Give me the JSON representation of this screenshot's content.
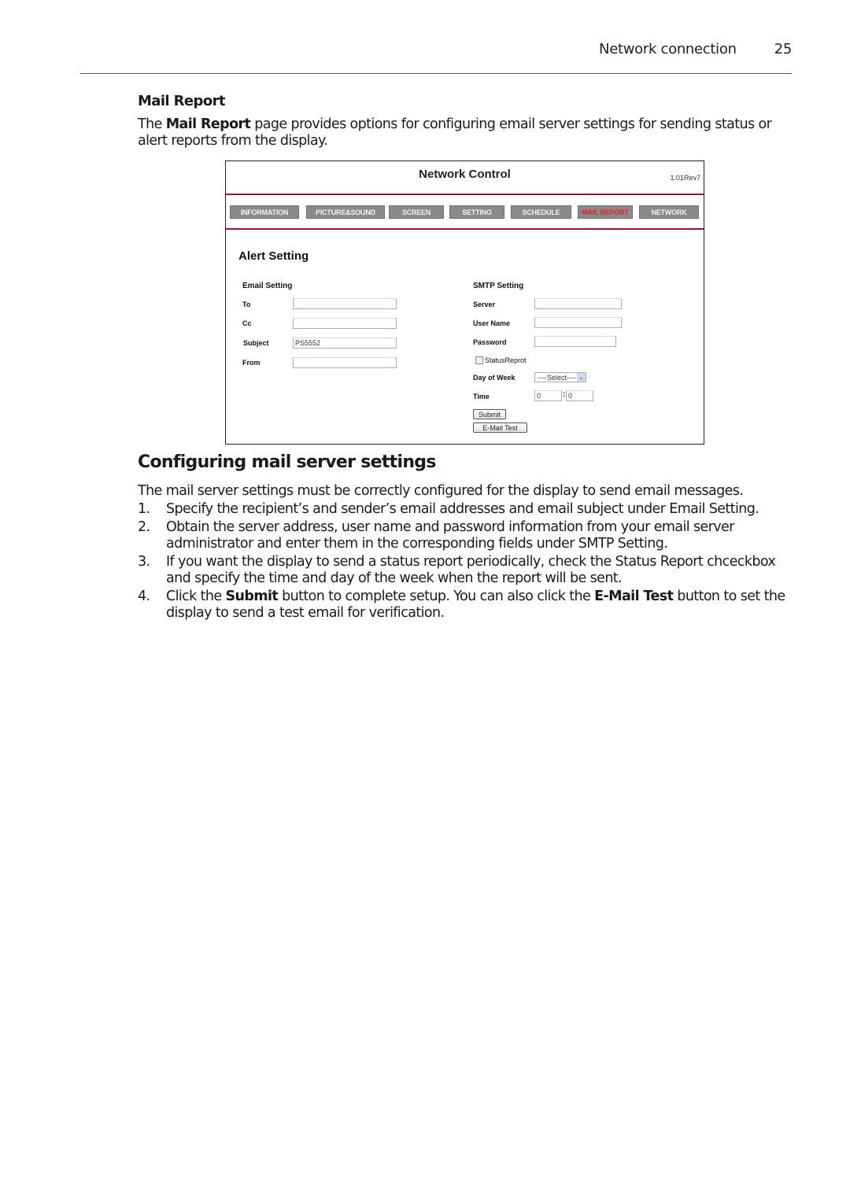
{
  "running_head": {
    "section": "Network connection",
    "page_number": "25"
  },
  "mail_report": {
    "heading": "Mail Report",
    "intro_prefix": "The ",
    "intro_bold": "Mail Report",
    "intro_suffix": " page provides options for configuring email server settings for sending status or alert reports from the display."
  },
  "screenshot": {
    "title": "Network Control",
    "version": "1.01Rev7",
    "accent_color": "#a0103a",
    "active_tab_color": "#e4252a",
    "nav": [
      {
        "label": "INFORMATION",
        "active": false
      },
      {
        "label": "PICTURE&SOUND",
        "active": false
      },
      {
        "label": "SCREEN",
        "active": false
      },
      {
        "label": "SETTING",
        "active": false
      },
      {
        "label": "SCHEDULE",
        "active": false
      },
      {
        "label": "MAIL REPORT",
        "active": true
      },
      {
        "label": "NETWORK",
        "active": false
      }
    ],
    "section_title": "Alert Setting",
    "email_setting": {
      "heading": "Email Setting",
      "fields": [
        {
          "label": "To",
          "value": ""
        },
        {
          "label": "Cc",
          "value": ""
        },
        {
          "label": "Subject",
          "value": "PS5552"
        },
        {
          "label": "From",
          "value": ""
        }
      ]
    },
    "smtp_setting": {
      "heading": "SMTP Setting",
      "server_label": "Server",
      "server_value": "",
      "username_label": "User Name",
      "username_value": "",
      "password_label": "Password",
      "password_value": "",
      "status_checkbox_label": "StatusReprot",
      "status_checked": false,
      "day_label": "Day of Week",
      "day_selected": "----Select----",
      "time_label": "Time",
      "time_hour": "0",
      "time_separator": ":",
      "time_minute": "0",
      "submit_label": "Submit",
      "email_test_label": "E-Mail Test"
    }
  },
  "configuring": {
    "heading": "Configuring mail server settings",
    "intro": "The mail server settings must be correctly configured for the display to send email messages.",
    "steps": [
      {
        "num": "1.",
        "text": "Specify the recipient’s and sender’s email addresses and email subject under Email Setting."
      },
      {
        "num": "2.",
        "text": "Obtain the server address, user name and password information from your email server administrator and enter them in the corresponding fields under SMTP Setting."
      },
      {
        "num": "3.",
        "text": "If you want the display to send a status report periodically, check the Status Report chceckbox and specify the time and day of the week when the report will be sent."
      },
      {
        "num": "4.",
        "pre": "Click the ",
        "b1": "Submit",
        "mid": " button to complete setup. You can also click the ",
        "b2": "E-Mail Test",
        "post": " button to set the display to send a test email for verification."
      }
    ]
  }
}
